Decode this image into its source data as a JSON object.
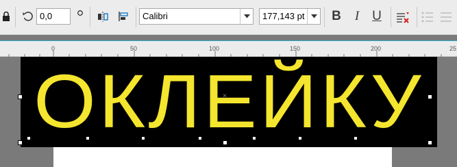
{
  "toolbar": {
    "rotation_value": "0,0",
    "font_name": "Calibri",
    "font_size": "177,143 pt",
    "bold_label": "B",
    "italic_label": "I",
    "underline_label": "U",
    "icons": [
      "lock-icon",
      "rotate-icon",
      "degree-icon",
      "mirror-horizontal-icon",
      "align-icon",
      "bold-icon",
      "italic-icon",
      "underline-icon",
      "clear-format-icon",
      "bullet-list-icon",
      "list-icon"
    ]
  },
  "ruler": {
    "labels": [
      "0",
      "50",
      "100",
      "150",
      "200",
      "25"
    ]
  },
  "canvas": {
    "banner_text": "ОКЛЕЙКУ",
    "banner_text_color": "#f4e52e",
    "banner_background": "#000000"
  }
}
